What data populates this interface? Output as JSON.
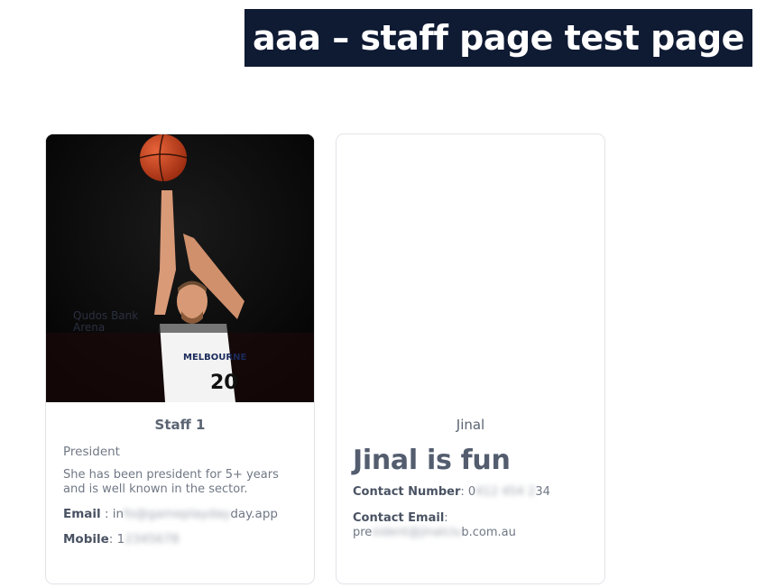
{
  "header": {
    "title": "aaa – staff page test page"
  },
  "cards": [
    {
      "name": "Staff 1",
      "role": "President",
      "bio": "She has been president for 5+ years and is well known in the sector.",
      "email_label": "Email",
      "email_value_visible_start": "in",
      "email_value_hidden": "fo@gameplayday",
      "email_value_visible_end": "day.app",
      "mobile_label": "Mobile",
      "mobile_value_visible_start": "1",
      "mobile_value_hidden": "2345678"
    },
    {
      "name": "Jinal",
      "headline": "Jinal is fun",
      "contact_number_label": "Contact Number",
      "contact_number_visible_start": "0",
      "contact_number_hidden": "412 454 2",
      "contact_number_visible_end": "34",
      "contact_email_label": "Contact Email",
      "contact_email_visible_start": "pre",
      "contact_email_hidden": "sident@jinalclu",
      "contact_email_visible_end": "b.com.au"
    }
  ],
  "colors": {
    "banner_bg": "#0f1a33",
    "banner_text": "#ffffff",
    "card_border": "#e2e4e8",
    "text_muted": "#707885",
    "text_strong": "#4a5363"
  },
  "icons": {
    "photo": "basketball-player-photo"
  }
}
